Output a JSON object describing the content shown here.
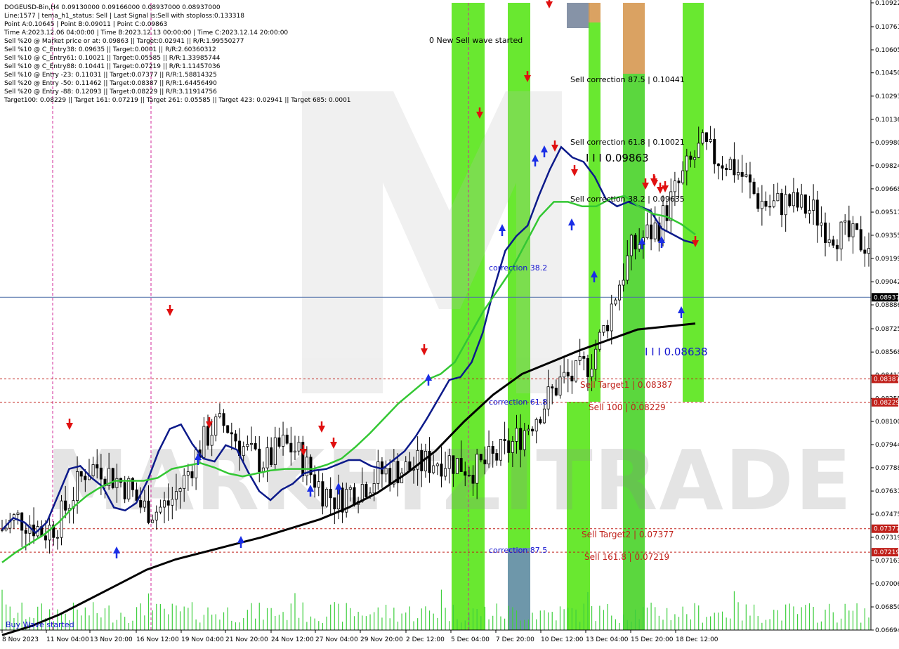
{
  "chart_data": {
    "type": "candlestick",
    "symbol_header": "DOGEUSD-Bin,H4  0.09130000 0.09166000 0.08937000 0.08937000",
    "info_lines": [
      "Line:1577 | tema_h1_status: Sell | Last Signal is:Sell with stoploss:0.133318",
      "Point A:0.10645 | Point B:0.09011 | Point C:0.09863",
      "Time A:2023.12.06 04:00:00 | Time B:2023.12.13 00:00:00 | Time C:2023.12.14 20:00:00",
      "Sell %20 @ Market price or at: 0.09863 || Target:0.02941 || R/R:1.99550277",
      "Sell %10 @ C_Entry38: 0.09635 || Target:0.0001 || R/R:2.60360312",
      "Sell %10 @ C_Entry61: 0.10021 || Target:0.05585 || R/R:1.33985744",
      "Sell %10 @ C_Entry88: 0.10441 || Target:0.07219 || R/R:1.11457036",
      "Sell %10 @ Entry -23: 0.11031 || Target:0.07377 || R/R:1.58814325",
      "Sell %20 @ Entry -50: 0.11462 || Target:0.08387 || R/R:1.64456490",
      "Sell %20 @ Entry -88: 0.12093 || Target:0.08229 || R/R:3.11914756",
      "Target100: 0.08229 || Target 161: 0.07219 || Target 261: 0.05585 || Target 423: 0.02941 || Target 685: 0.0001"
    ],
    "y_ticks": [
      "0.10922",
      "0.10761",
      "0.10605",
      "0.10450",
      "0.10293",
      "0.10136",
      "0.09980",
      "0.09824",
      "0.09668",
      "0.09511",
      "0.09355",
      "0.09199",
      "0.09042",
      "0.08886",
      "0.08725",
      "0.08568",
      "0.08412",
      "0.08255",
      "0.08100",
      "0.07944",
      "0.07788",
      "0.07631",
      "0.07475",
      "0.07319",
      "0.07163",
      "0.07006",
      "0.06850",
      "0.06694"
    ],
    "x_ticks": [
      "8 Nov 2023",
      "11 Nov 04:00",
      "13 Nov 20:00",
      "16 Nov 12:00",
      "19 Nov 04:00",
      "21 Nov 20:00",
      "24 Nov 12:00",
      "27 Nov 04:00",
      "29 Nov 20:00",
      "2 Dec 12:00",
      "5 Dec 04:00",
      "7 Dec 20:00",
      "10 Dec 12:00",
      "13 Dec 04:00",
      "15 Dec 20:00",
      "18 Dec 12:00"
    ],
    "ylim": [
      0.06694,
      0.10922
    ],
    "current_price": "0.08937",
    "level_lines": [
      {
        "label": "0.08387",
        "value": 0.08387,
        "color": "#c0201a"
      },
      {
        "label": "0.08229",
        "value": 0.08229,
        "color": "#c0201a"
      },
      {
        "label": "0.07377",
        "value": 0.07377,
        "color": "#c0201a"
      },
      {
        "label": "0.07219",
        "value": 0.07219,
        "color": "#c0201a"
      }
    ],
    "annotations": [
      {
        "text": "0 New Sell wave started",
        "color": "#000000"
      },
      {
        "text": "Sell correction 87.5 | 0.10441",
        "color": "#000000"
      },
      {
        "text": "Sell correction 61.8 | 0.10021",
        "color": "#000000"
      },
      {
        "text": "I I I 0.09863",
        "color": "#000000"
      },
      {
        "text": "Sell correction 38.2 | 0.09635",
        "color": "#000000"
      },
      {
        "text": "correction 38.2",
        "color": "#1515d0"
      },
      {
        "text": "correction 61.8",
        "color": "#1515d0"
      },
      {
        "text": "correction 87.5",
        "color": "#1515d0"
      },
      {
        "text": "I I I 0.08638",
        "color": "#1515d0"
      },
      {
        "text": "Sell Target1 | 0.08387",
        "color": "#c0201a"
      },
      {
        "text": "Sell 100 | 0.08229",
        "color": "#c0201a"
      },
      {
        "text": "Sell Target2 | 0.07377",
        "color": "#c0201a"
      },
      {
        "text": "Sell 161.8 | 0.07219",
        "color": "#c0201a"
      },
      {
        "text": "Buy Wave started",
        "color": "#1515d0"
      }
    ],
    "series": [
      {
        "name": "",
        "color": "#0c1a8a",
        "values": [
          0.0737,
          0.0745,
          0.0742,
          0.0735,
          0.0742,
          0.076,
          0.0778,
          0.078,
          0.0772,
          0.0766,
          0.0752,
          0.075,
          0.0755,
          0.077,
          0.079,
          0.0805,
          0.0808,
          0.0795,
          0.0785,
          0.0783,
          0.0794,
          0.0791,
          0.0776,
          0.0763,
          0.0757,
          0.0764,
          0.0768,
          0.0775,
          0.0777,
          0.0778,
          0.0781,
          0.0784,
          0.0784,
          0.078,
          0.0778,
          0.0784,
          0.079,
          0.08,
          0.0812,
          0.0825,
          0.0838,
          0.084,
          0.085,
          0.087,
          0.09,
          0.0925,
          0.0935,
          0.0942,
          0.0962,
          0.098,
          0.0995,
          0.0988,
          0.0985,
          0.0975,
          0.096,
          0.0955,
          0.0958,
          0.0955,
          0.0952,
          0.094,
          0.0936,
          0.0932,
          0.093
        ]
      },
      {
        "name": "",
        "color": "#33c733",
        "values": [
          0.0715,
          0.0722,
          0.0728,
          0.0734,
          0.0742,
          0.0752,
          0.076,
          0.0766,
          0.077,
          0.077,
          0.077,
          0.0772,
          0.0778,
          0.078,
          0.0782,
          0.0779,
          0.0775,
          0.0773,
          0.0775,
          0.0777,
          0.0778,
          0.0778,
          0.0778,
          0.0781,
          0.0785,
          0.0793,
          0.0802,
          0.0812,
          0.0822,
          0.083,
          0.0838,
          0.0842,
          0.085,
          0.0867,
          0.0884,
          0.0898,
          0.0912,
          0.093,
          0.0948,
          0.0958,
          0.0958,
          0.0955,
          0.0955,
          0.096,
          0.0962,
          0.0955,
          0.095,
          0.0948,
          0.0943,
          0.0936
        ]
      },
      {
        "name": "",
        "color": "#000000",
        "values": [
          0.0666,
          0.0672,
          0.068,
          0.069,
          0.07,
          0.071,
          0.0717,
          0.0722,
          0.0727,
          0.0732,
          0.0738,
          0.0744,
          0.0752,
          0.0762,
          0.0775,
          0.079,
          0.081,
          0.0828,
          0.0842,
          0.085,
          0.0858,
          0.0865,
          0.0872,
          0.0874,
          0.0876
        ]
      }
    ],
    "signals": {
      "sell_arrows": 18,
      "buy_arrows": 14
    },
    "logo_text": "MARKETZITRADE"
  },
  "colors": {
    "bright_green": "#5ce61e",
    "green": "#4dd42e",
    "orange": "#d79a55",
    "steel_blue": "#6f8fb5",
    "grey_blue": "#7c8aa0",
    "navy": "#0c1a8a",
    "ma_green": "#33c733",
    "current_line": "#4f6fa8"
  }
}
